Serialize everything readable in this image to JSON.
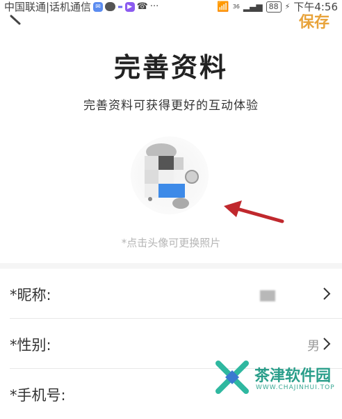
{
  "status_bar": {
    "carrier": "中国联通|话机通信",
    "battery": "88",
    "time": "下午4:56",
    "network": "36"
  },
  "header": {
    "save_label": "保存",
    "title": "完善资料",
    "subtitle": "完善资料可获得更好的互动体验"
  },
  "avatar": {
    "hint": "*点击头像可更换照片"
  },
  "form": {
    "rows": [
      {
        "label": "*昵称:",
        "value": ""
      },
      {
        "label": "*性别:",
        "value": "男"
      },
      {
        "label": "*手机号:",
        "value": ""
      }
    ]
  },
  "watermark": {
    "name": "茶津软件园",
    "url": "WWW.CHAJINHUI.TOP"
  },
  "colors": {
    "accent": "#e8a33a",
    "arrow": "#c0282d",
    "watermark": "#2a9e8a"
  }
}
